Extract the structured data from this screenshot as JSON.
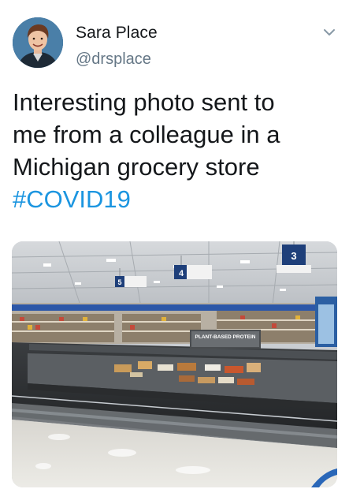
{
  "tweet": {
    "author": {
      "display_name": "Sara Place",
      "handle": "@drsplace",
      "avatar": "profile-photo"
    },
    "menu_icon": "chevron-down-icon",
    "text_lines": [
      "Interesting photo sent to",
      "me from a colleague in a",
      "Michigan grocery store"
    ],
    "hashtag": "#COVID19",
    "media": {
      "description_icon": "photo",
      "aisle_signs": [
        "3",
        "4",
        "5"
      ],
      "shelf_sign": "PLANT-BASED PROTEIN"
    }
  },
  "colors": {
    "text": "#14171a",
    "secondary": "#657786",
    "link": "#1b95e0"
  }
}
